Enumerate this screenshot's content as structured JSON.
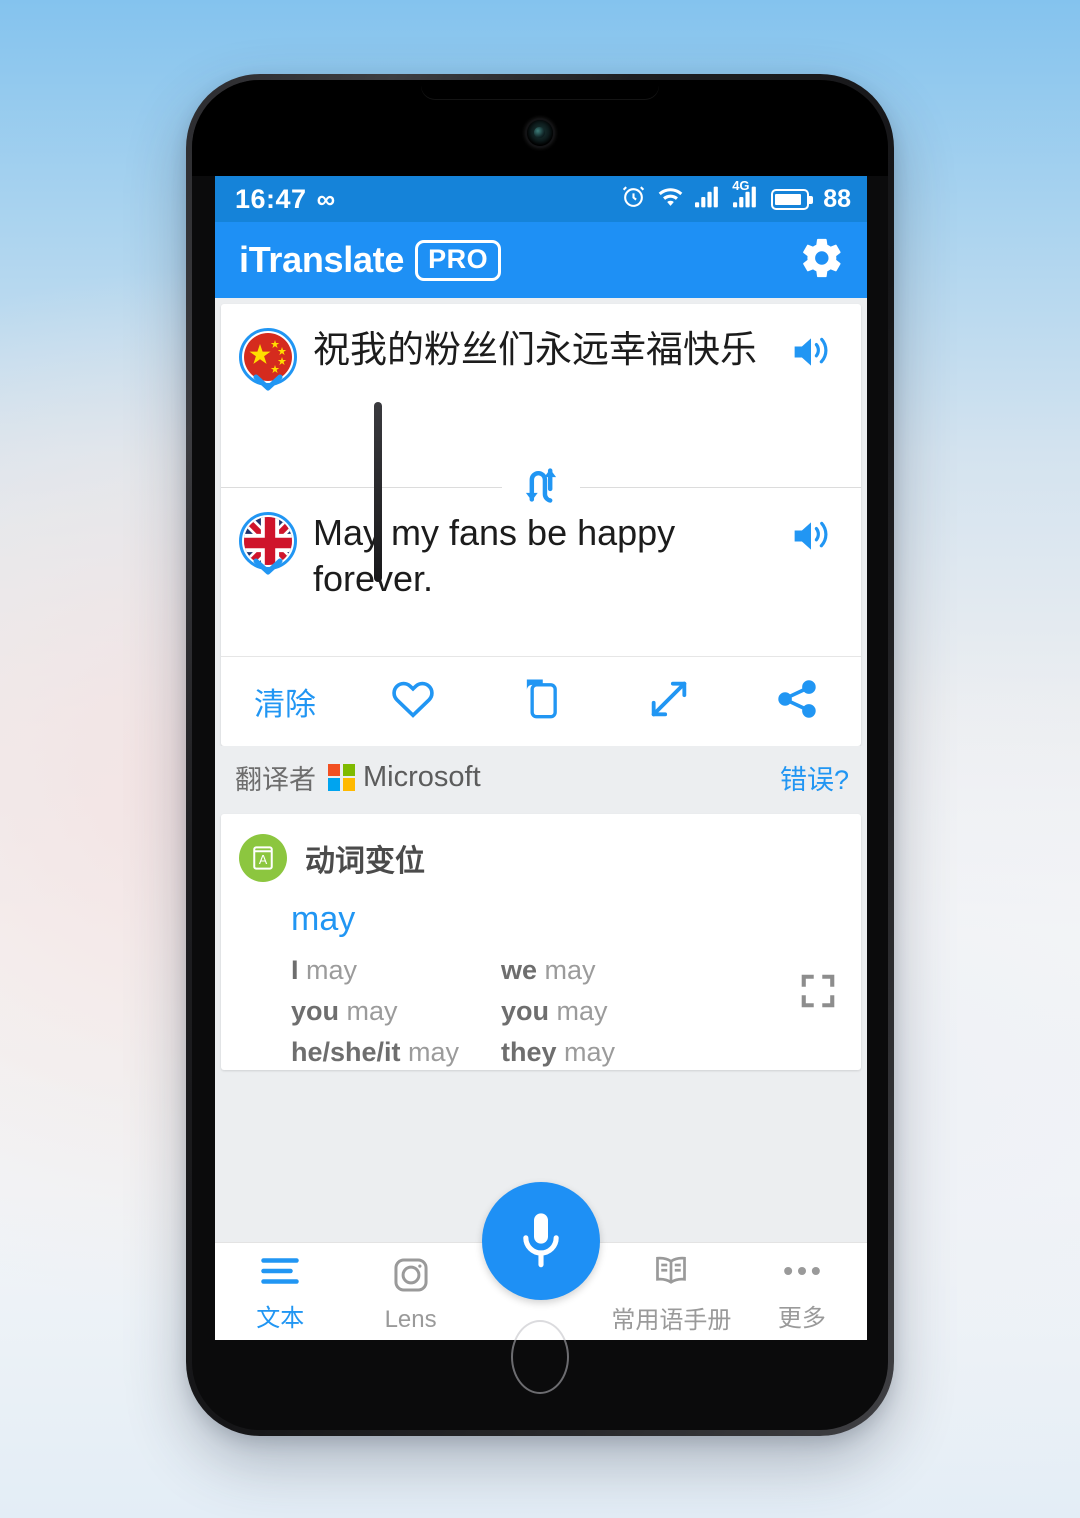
{
  "status_bar": {
    "time": "16:47",
    "infinity_icon": "infinity-icon",
    "alarm_icon": "alarm-icon",
    "wifi_icon": "wifi-icon",
    "signal_icon": "signal-bars-icon",
    "signal_4g_icon": "signal-bars-4g-icon",
    "network_label": "4G",
    "battery_icon": "battery-icon",
    "battery_level": "88"
  },
  "app_bar": {
    "brand": "iTranslate",
    "pro_badge": "PRO",
    "settings_icon": "gear-icon"
  },
  "translation": {
    "source": {
      "flag": "china-flag-icon",
      "language": "Chinese",
      "text": "祝我的粉丝们永远幸福快乐",
      "speaker_icon": "speaker-icon"
    },
    "swap_icon": "swap-languages-icon",
    "target": {
      "flag": "uk-flag-icon",
      "language": "English",
      "text": "May my fans be happy forever.",
      "speaker_icon": "speaker-icon"
    }
  },
  "actions": {
    "clear_label": "清除",
    "favorite_icon": "heart-icon",
    "copy_icon": "copy-icon",
    "expand_icon": "expand-arrows-icon",
    "share_icon": "share-icon"
  },
  "attribution": {
    "label": "翻译者",
    "provider": "Microsoft",
    "provider_logo": "microsoft-logo-icon",
    "error_link": "错误?"
  },
  "conjugation": {
    "icon": "dictionary-card-icon",
    "title": "动词变位",
    "word": "may",
    "rows": [
      {
        "left_pronoun": "I",
        "left_verb": "may",
        "right_pronoun": "we",
        "right_verb": "may"
      },
      {
        "left_pronoun": "you",
        "left_verb": "may",
        "right_pronoun": "you",
        "right_verb": "may"
      },
      {
        "left_pronoun": "he/she/it",
        "left_verb": "may",
        "right_pronoun": "they",
        "right_verb": "may"
      }
    ],
    "expand_icon": "fullscreen-icon"
  },
  "bottom_nav": {
    "items": [
      {
        "label": "文本",
        "icon": "text-lines-icon",
        "active": true
      },
      {
        "label": "Lens",
        "icon": "camera-lens-icon",
        "active": false
      },
      {
        "label": "常用语手册",
        "icon": "phrasebook-icon",
        "active": false
      },
      {
        "label": "更多",
        "icon": "more-dots-icon",
        "active": false
      }
    ],
    "mic_fab_icon": "microphone-icon"
  },
  "colors": {
    "accent": "#2196f3",
    "appbar": "#1e90f5",
    "statusbar": "#1583d9",
    "conj_icon_green": "#8cc63f"
  }
}
